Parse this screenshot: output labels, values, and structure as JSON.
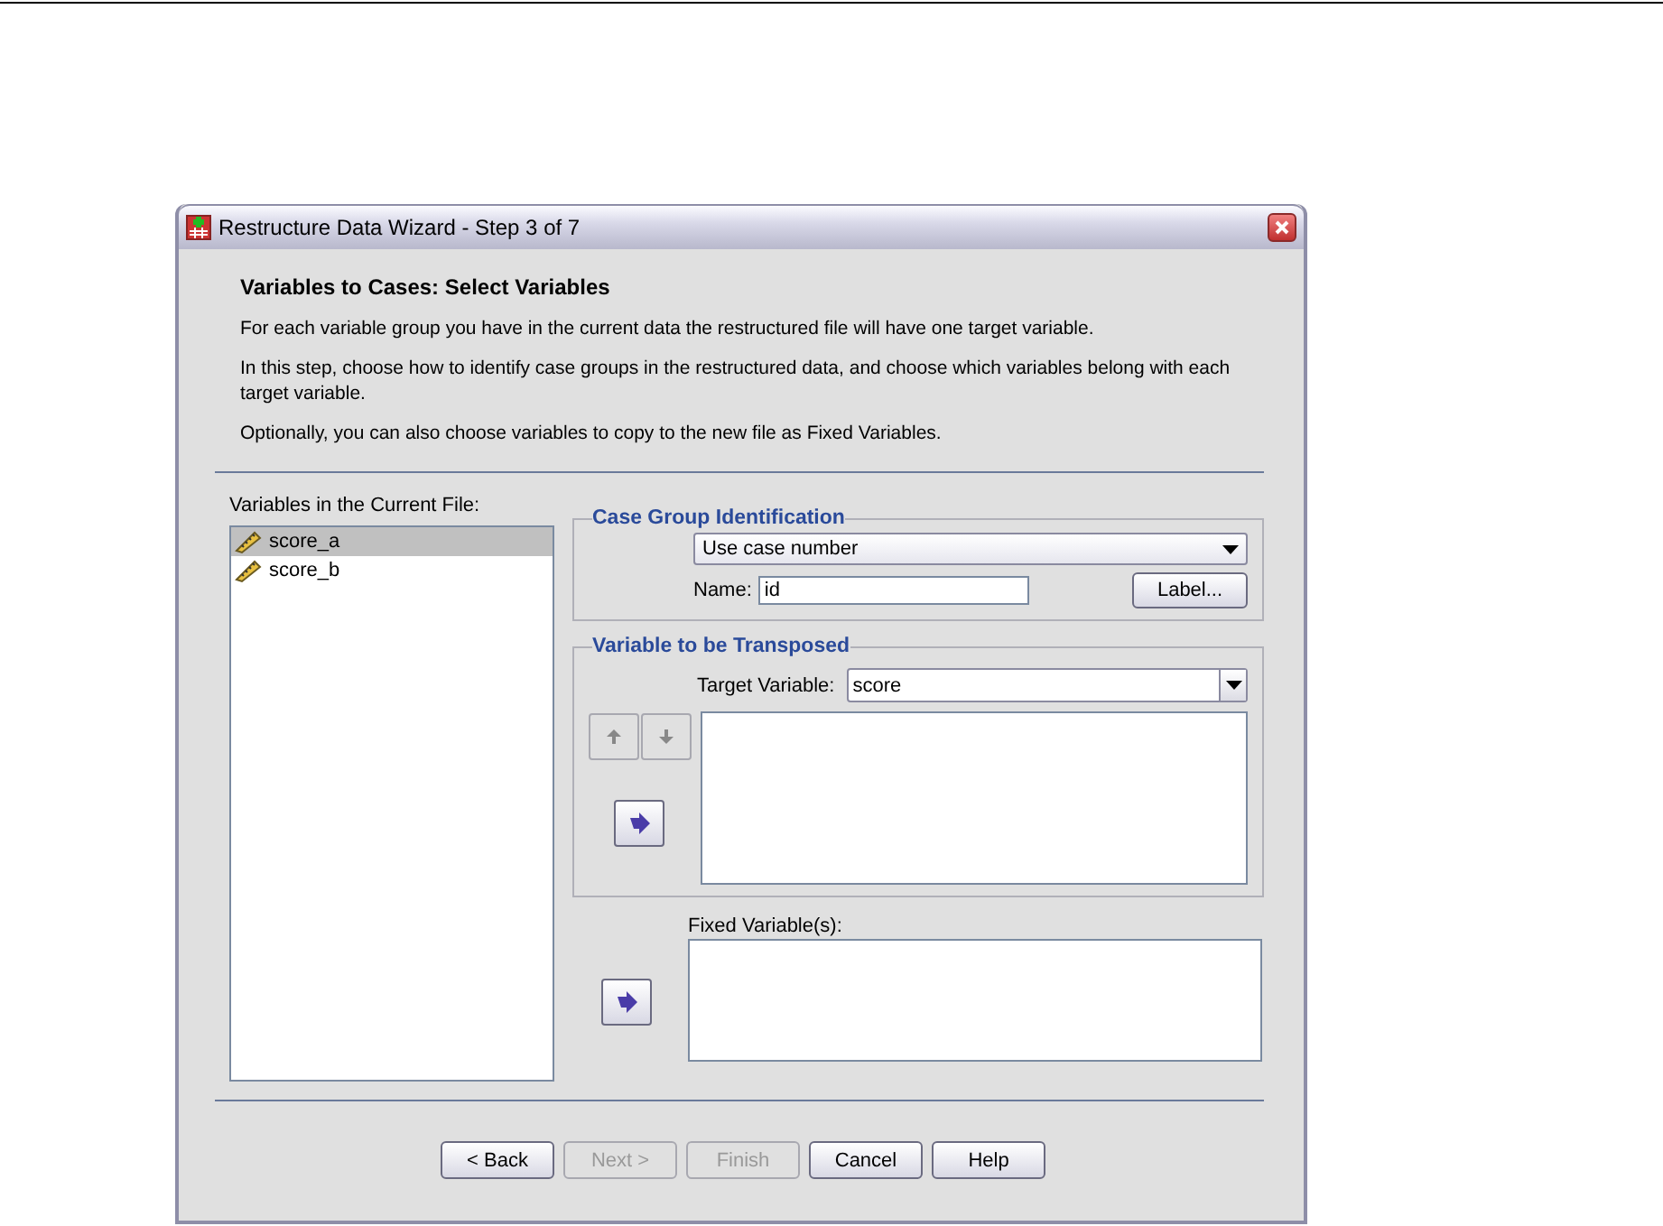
{
  "window": {
    "title": "Restructure Data Wizard - Step 3 of 7"
  },
  "heading": "Variables to Cases: Select Variables",
  "paragraphs": [
    "For each variable group you have in the current data the restructured file will have one target variable.",
    "In this step, choose how to identify case groups in the restructured data, and choose which variables belong with each target variable.",
    "Optionally, you can also choose variables to copy to the new file as Fixed Variables."
  ],
  "source_list": {
    "label": "Variables in the Current File:",
    "items": [
      {
        "name": "score_a",
        "selected": true
      },
      {
        "name": "score_b",
        "selected": false
      }
    ]
  },
  "case_group": {
    "title": "Case Group Identification",
    "method": "Use case number",
    "name_label": "Name:",
    "name_value": "id",
    "label_button": "Label..."
  },
  "transpose": {
    "title": "Variable to be Transposed",
    "target_label": "Target Variable:",
    "target_value": "score",
    "move_up_disabled": true,
    "move_down_disabled": true
  },
  "fixed": {
    "label": "Fixed Variable(s):"
  },
  "buttons": [
    {
      "label": "< Back",
      "disabled": false
    },
    {
      "label": "Next >",
      "disabled": true
    },
    {
      "label": "Finish",
      "disabled": true
    },
    {
      "label": "Cancel",
      "disabled": false
    },
    {
      "label": "Help",
      "disabled": false
    }
  ]
}
